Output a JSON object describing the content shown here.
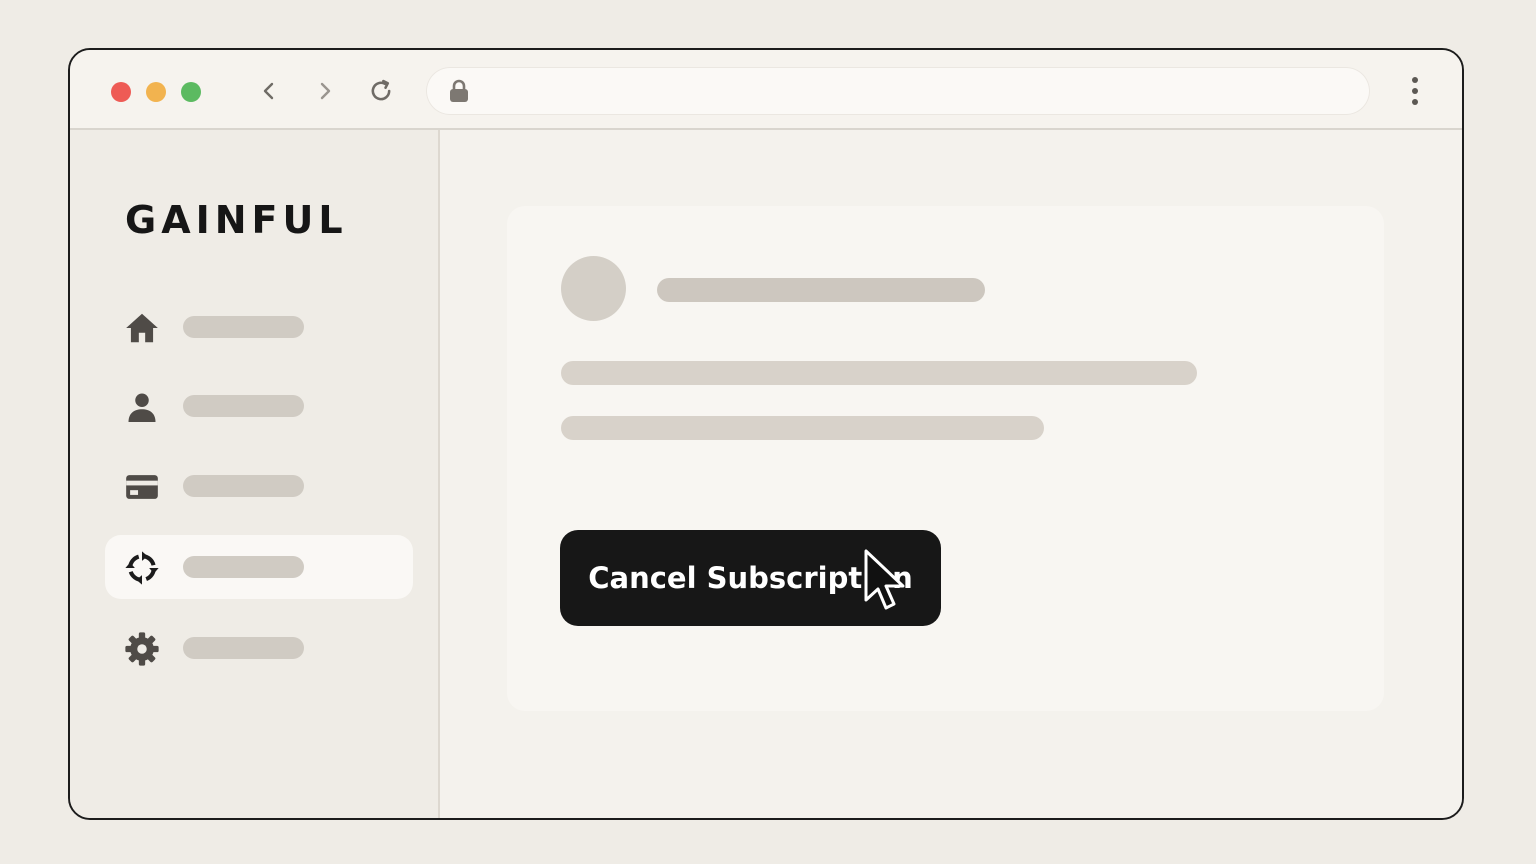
{
  "brand": {
    "name": "GAINFUL"
  },
  "colors": {
    "traffic_red": "#ee5b55",
    "traffic_yellow": "#f2b34f",
    "traffic_green": "#5cba61",
    "button_bg": "#171717",
    "button_text": "#ffffff"
  },
  "browser": {
    "icons": [
      "chevron-left-icon",
      "chevron-right-icon",
      "reload-icon",
      "lock-icon",
      "more-vertical-icon"
    ]
  },
  "sidebar": {
    "items": [
      {
        "icon": "home-icon",
        "active": false
      },
      {
        "icon": "user-icon",
        "active": false
      },
      {
        "icon": "credit-card-icon",
        "active": false
      },
      {
        "icon": "subscription-cycle-icon",
        "active": true
      },
      {
        "icon": "gear-icon",
        "active": false
      }
    ]
  },
  "main": {
    "cancel_button_label": "Cancel Subscription"
  }
}
